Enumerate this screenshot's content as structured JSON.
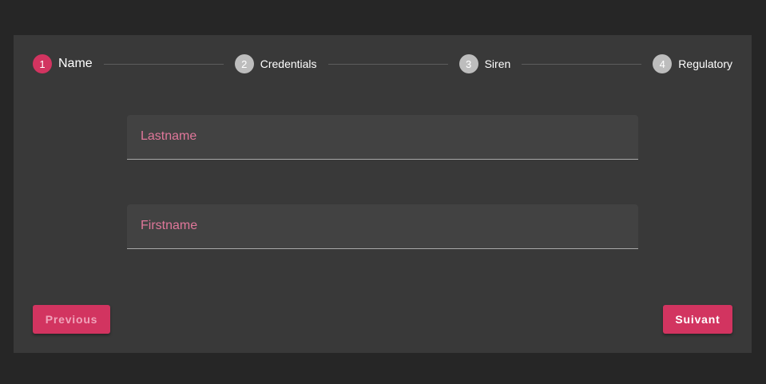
{
  "stepper": {
    "steps": [
      {
        "number": "1",
        "label": "Name",
        "state": "active"
      },
      {
        "number": "2",
        "label": "Credentials",
        "state": "inactive"
      },
      {
        "number": "3",
        "label": "Siren",
        "state": "inactive"
      },
      {
        "number": "4",
        "label": "Regulatory",
        "state": "inactive"
      }
    ]
  },
  "form": {
    "lastname_label": "Lastname",
    "lastname_value": "",
    "firstname_label": "Firstname",
    "firstname_value": ""
  },
  "actions": {
    "previous_label": "Previous",
    "next_label": "Suivant"
  },
  "colors": {
    "accent": "#d23460",
    "card_background": "#393939",
    "page_background": "#262626",
    "inactive_step": "#bdbdbd"
  }
}
